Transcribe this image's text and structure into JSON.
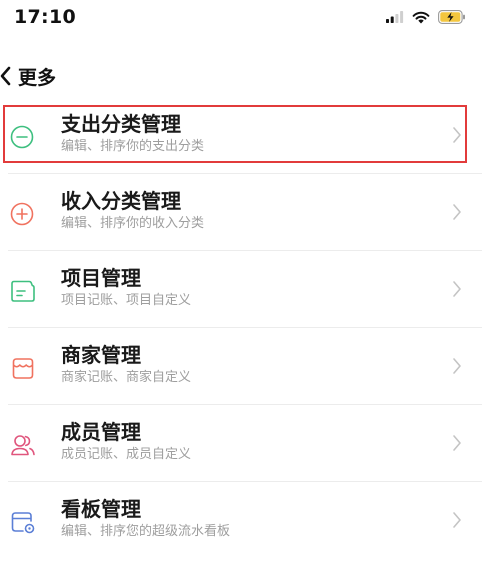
{
  "status_bar": {
    "time": "17:10",
    "icons": [
      "cellular-signal-icon",
      "wifi-icon",
      "battery-charging-icon"
    ]
  },
  "nav": {
    "title": "更多",
    "back_icon": "chevron-left-icon"
  },
  "list": [
    {
      "title": "支出分类管理",
      "subtitle": "编辑、排序你的支出分类",
      "icon": "minus-circle-icon",
      "icon_color": "#3dbf7f",
      "highlighted": true
    },
    {
      "title": "收入分类管理",
      "subtitle": "编辑、排序你的收入分类",
      "icon": "plus-circle-icon",
      "icon_color": "#f0725f"
    },
    {
      "title": "项目管理",
      "subtitle": "项目记账、项目自定义",
      "icon": "folder-icon",
      "icon_color": "#3dbf7f"
    },
    {
      "title": "商家管理",
      "subtitle": "商家记账、商家自定义",
      "icon": "shop-icon",
      "icon_color": "#f0725f"
    },
    {
      "title": "成员管理",
      "subtitle": "成员记账、成员自定义",
      "icon": "members-icon",
      "icon_color": "#e0557d"
    },
    {
      "title": "看板管理",
      "subtitle": "编辑、排序您的超级流水看板",
      "icon": "dashboard-icon",
      "icon_color": "#5b7fd6"
    }
  ],
  "colors": {
    "highlight_border": "#e23b3b",
    "chevron": "#c4c4c4",
    "subtitle": "#9e9e9e"
  }
}
